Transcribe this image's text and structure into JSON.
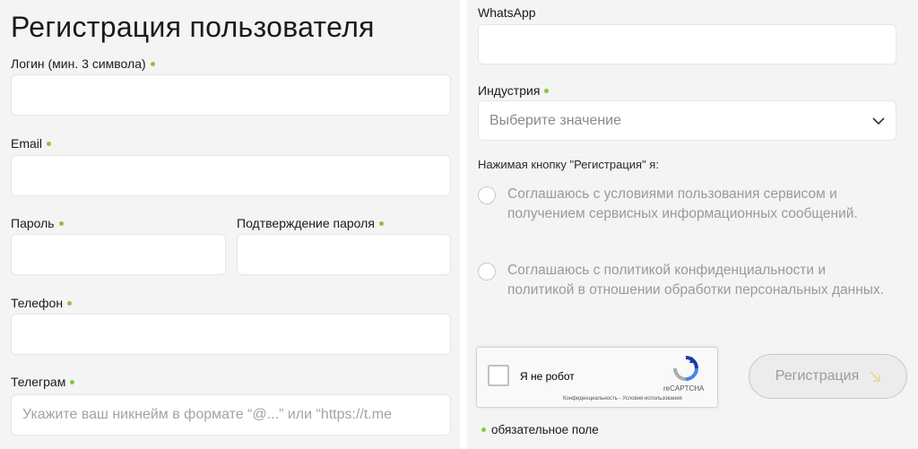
{
  "form": {
    "title": "Регистрация пользователя",
    "login_label": "Логин (мин. 3 символа)",
    "login_value": "",
    "email_label": "Email",
    "email_value": "",
    "password_label": "Пароль",
    "password_value": "",
    "password_confirm_label": "Подтверждение пароля",
    "password_confirm_value": "",
    "phone_label": "Телефон",
    "phone_value": "",
    "telegram_label": "Телеграм",
    "telegram_placeholder": "Укажите ваш никнейм в формате “@...” или “https://t.me",
    "whatsapp_label": "WhatsApp",
    "whatsapp_value": "",
    "industry_label": "Индустрия",
    "industry_placeholder": "Выберите значение",
    "consent_intro": "Нажимая кнопку \"Регистрация\" я:",
    "consent_terms": "Соглашаюсь с условиями пользования сервисом и получением сервисных информационных сообщений.",
    "consent_privacy": "Соглашаюсь с политикой конфиденциальности и политикой в отношении обработки персональных данных.",
    "submit_label": "Регистрация",
    "required_note": "обязательное поле"
  },
  "recaptcha": {
    "label": "Я не робот",
    "brand": "reCAPTCHA",
    "links": "Конфиденциальность - Условия использования"
  },
  "colors": {
    "required_dot": "#8bc34a",
    "background": "#f4f4f4",
    "field_bg": "#ffffff"
  },
  "icons": {
    "select_caret": "chevron-down-icon",
    "submit_arrow": "arrow-down-right-icon",
    "recaptcha_logo": "recaptcha-logo-icon"
  }
}
